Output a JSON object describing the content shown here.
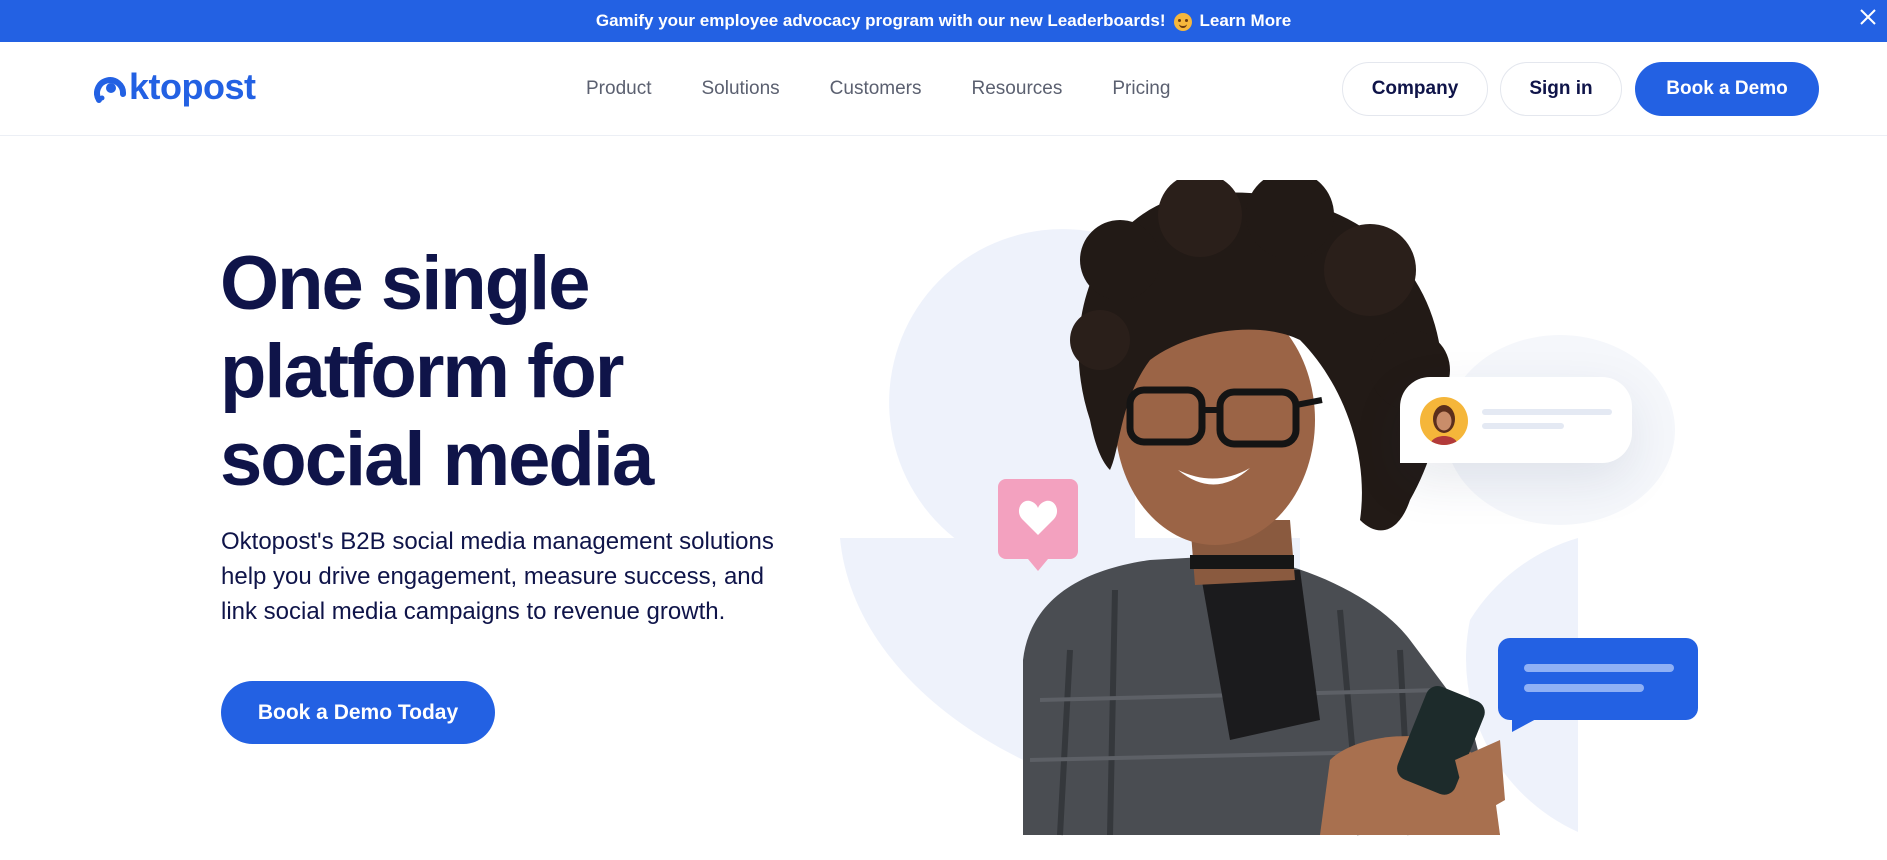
{
  "announcement": {
    "text": "Gamify your employee advocacy program with our new Leaderboards!",
    "link_label": "Learn More"
  },
  "header": {
    "logo_text": "ktopost",
    "nav": [
      "Product",
      "Solutions",
      "Customers",
      "Resources",
      "Pricing"
    ],
    "company_label": "Company",
    "signin_label": "Sign in",
    "demo_label": "Book a Demo"
  },
  "hero": {
    "title_line1": "One single",
    "title_line2": "platform for",
    "title_line3": "social media",
    "description": "Oktopost's B2B social media management solutions help you drive engagement, measure success, and link social media campaigns to revenue growth.",
    "cta_label": "Book a Demo Today"
  },
  "colors": {
    "brand": "#2361e3",
    "heading": "#0f1449",
    "shape": "#eef2fb",
    "like": "#f3a1bf"
  }
}
